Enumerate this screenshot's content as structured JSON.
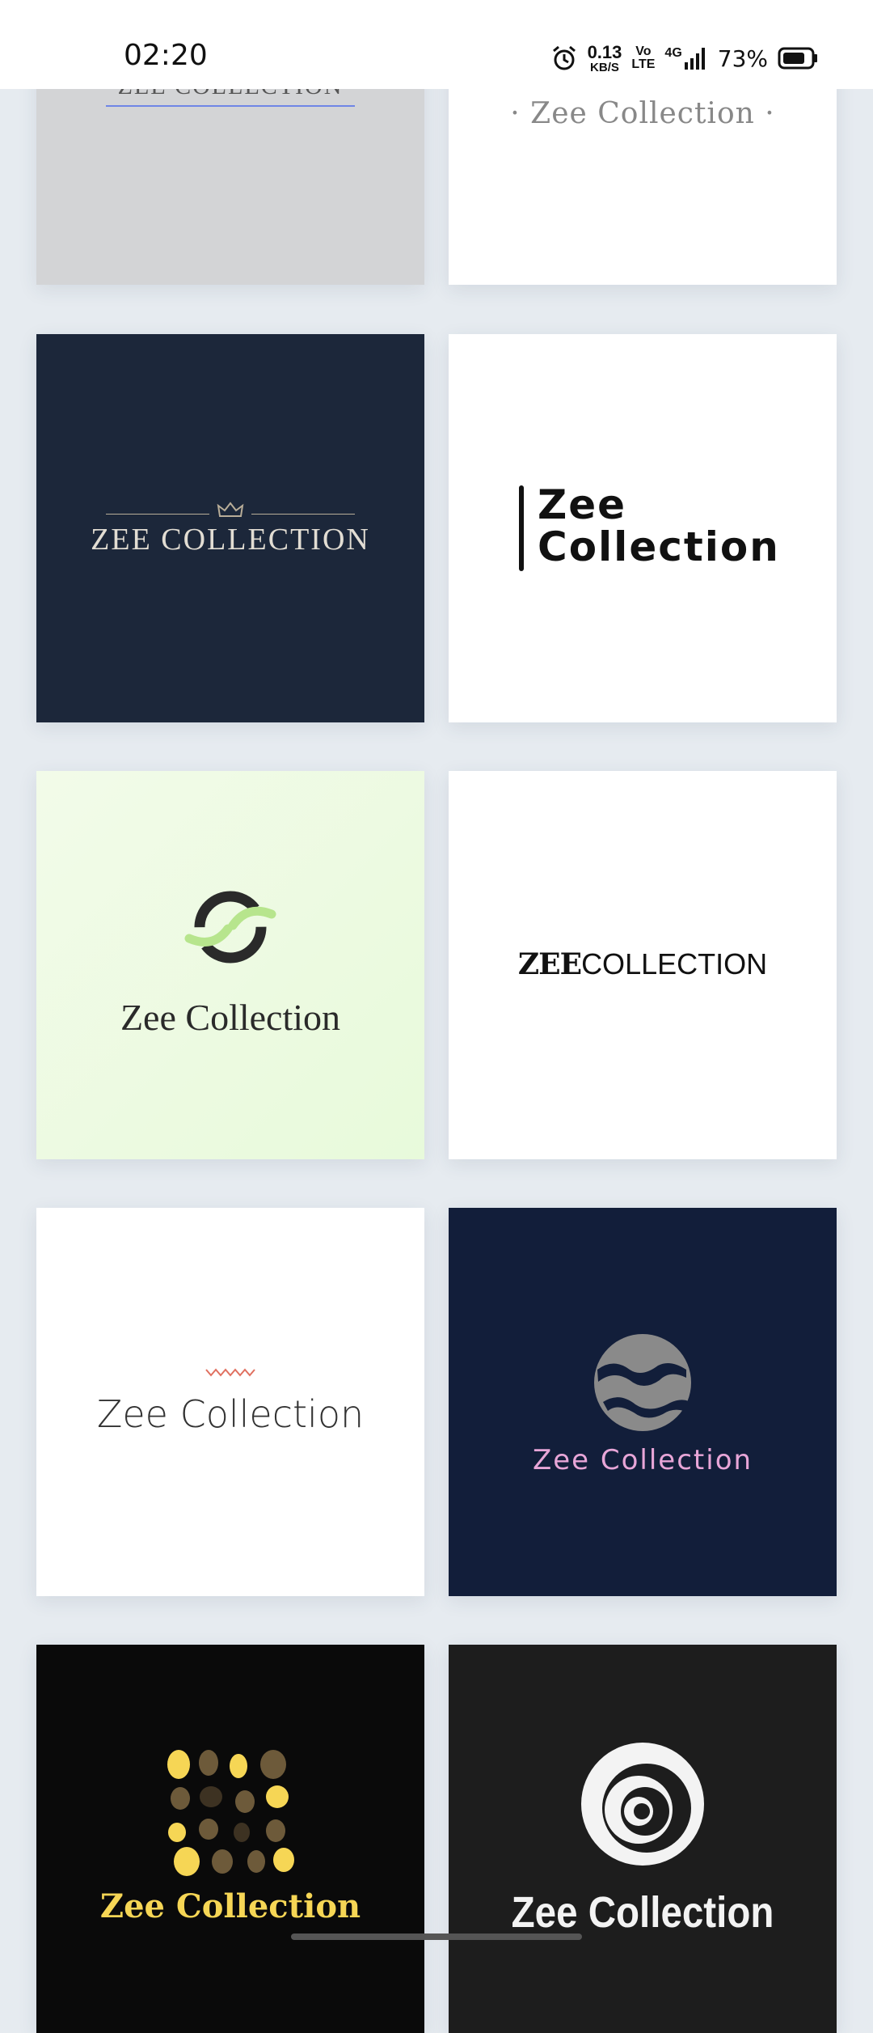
{
  "status_bar": {
    "time": "02:20",
    "net_speed": "0.13",
    "net_unit": "KB/S",
    "volte_top": "Vo",
    "volte_bottom": "LTE",
    "signal": "4G",
    "battery": "73%"
  },
  "logos": [
    {
      "text": "ZEE COLLECTION",
      "bg": "#d3d4d6"
    },
    {
      "text": "· Zee Collection ·",
      "bg": "#ffffff"
    },
    {
      "text": "ZEE COLLECTION",
      "bg": "#1c273a"
    },
    {
      "line1": "Zee",
      "line2": "Collection",
      "bg": "#ffffff"
    },
    {
      "text": "Zee Collection",
      "bg": "#eefbe1"
    },
    {
      "bold": "ZEE",
      "rest": "COLLECTION",
      "bg": "#ffffff"
    },
    {
      "text": "Zee Collection",
      "bg": "#ffffff"
    },
    {
      "text": "Zee Collection",
      "bg": "#121e3a"
    },
    {
      "text": "Zee Collection",
      "bg": "#0a0a0a"
    },
    {
      "text": "Zee Collection",
      "bg": "#1d1d1d"
    }
  ]
}
